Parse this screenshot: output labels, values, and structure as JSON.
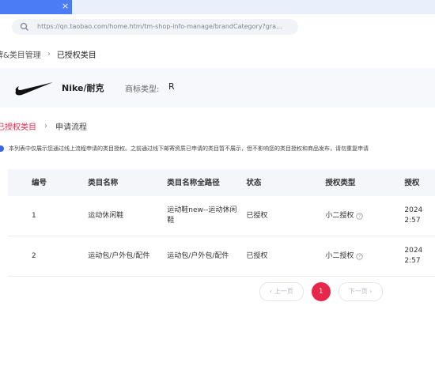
{
  "browser": {
    "tab_close": "×",
    "url": "https://qn.taobao.com/home.htm/tm-shop-info-manage/brandCategory?gra..."
  },
  "breadcrumb": {
    "parent": "牌&类目管理",
    "separator": "›",
    "current": "已授权类目"
  },
  "brand": {
    "name": "Nike/耐克",
    "trademark_label": "商标类型:",
    "trademark_value": "R"
  },
  "tabs": {
    "authorized": "已授权类目",
    "separator": "›",
    "process": "申请流程"
  },
  "notice": {
    "text": "本列表中仅展示您通过线上流程申请的类目授权。之前通过线下邮寄资质已申请的类目暂不展示，但不影响您的类目授权和商品发布，请勿重复申请"
  },
  "table": {
    "headers": [
      "编号",
      "类目名称",
      "类目名称全路径",
      "状态",
      "授权类型",
      "授权"
    ],
    "rows": [
      {
        "no": "1",
        "name": "运动休闲鞋",
        "path": "运动鞋new--运动休闲鞋",
        "status": "已授权",
        "type": "小二授权",
        "time_line1": "2024",
        "time_line2": "2:57"
      },
      {
        "no": "2",
        "name": "运动包/户外包/配件",
        "path": "运动包/户外包/配件",
        "status": "已授权",
        "type": "小二授权",
        "time_line1": "2024",
        "time_line2": "2:57"
      }
    ]
  },
  "pagination": {
    "prev": "‹ 上一页",
    "current": "1",
    "next": "下一页 ›"
  },
  "colors": {
    "accent": "#e8264a",
    "tab_active": "#4b7cf6",
    "notice_dot": "#3b63e6"
  }
}
